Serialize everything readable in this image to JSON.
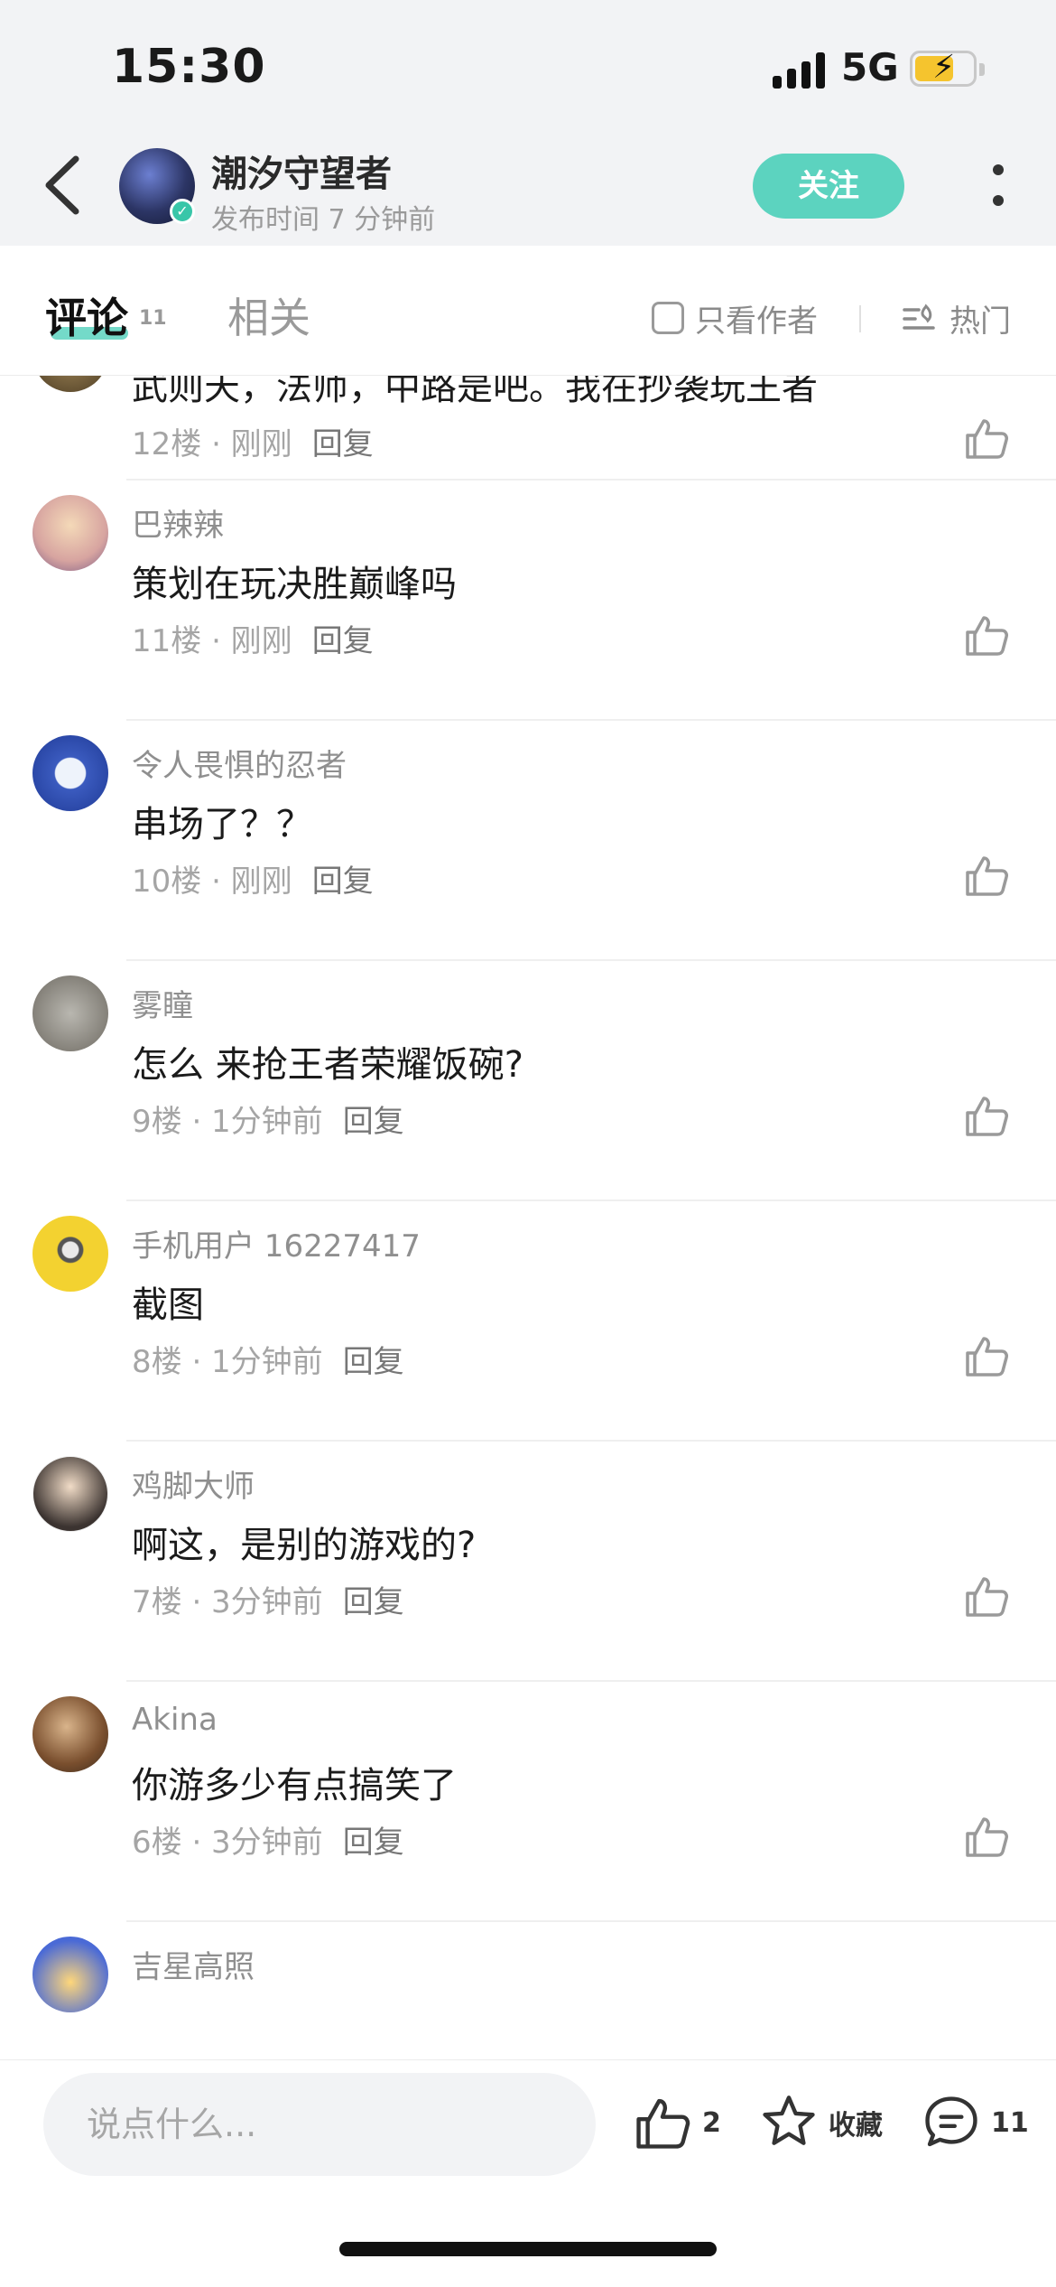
{
  "status": {
    "time": "15:30",
    "network": "5G"
  },
  "header": {
    "author": "潮汐守望者",
    "publish_time": "发布时间 7 分钟前",
    "follow_label": "关注"
  },
  "tabs": {
    "comments_label": "评论",
    "comments_count": "11",
    "related_label": "相关",
    "only_author_label": "只看作者",
    "sort_label": "热门"
  },
  "comments": [
    {
      "name": "",
      "text": "武则天，法师，中路是吧。我在抄袭玩王者",
      "floor": "12楼 · 刚刚",
      "reply": "回复"
    },
    {
      "name": "巴辣辣",
      "text": "策划在玩决胜巅峰吗",
      "floor": "11楼 · 刚刚",
      "reply": "回复"
    },
    {
      "name": "令人畏惧的忍者",
      "text": "串场了？？",
      "floor": "10楼 · 刚刚",
      "reply": "回复"
    },
    {
      "name": "雾瞳",
      "text": "怎么 来抢王者荣耀饭碗?",
      "floor": "9楼 · 1分钟前",
      "reply": "回复"
    },
    {
      "name": "手机用户 16227417",
      "text": "截图",
      "floor": "8楼 · 1分钟前",
      "reply": "回复"
    },
    {
      "name": "鸡脚大师",
      "text": "啊这，是别的游戏的?",
      "floor": "7楼 · 3分钟前",
      "reply": "回复"
    },
    {
      "name": "Akina",
      "text": "你游多少有点搞笑了",
      "floor": "6楼 · 3分钟前",
      "reply": "回复"
    },
    {
      "name": "吉星高照",
      "text": "",
      "floor": "",
      "reply": ""
    }
  ],
  "bottom": {
    "input_placeholder": "说点什么...",
    "like_count": "2",
    "favorite_label": "收藏",
    "comment_count": "11"
  },
  "colors": {
    "accent": "#5cd3bf",
    "header_bg": "#f2f3f5",
    "battery": "#f5c42e"
  },
  "icons": [
    "back-icon",
    "verified-icon",
    "more-icon",
    "checkbox-icon",
    "hot-sort-icon",
    "thumbs-up-icon",
    "star-icon",
    "comment-icon"
  ]
}
